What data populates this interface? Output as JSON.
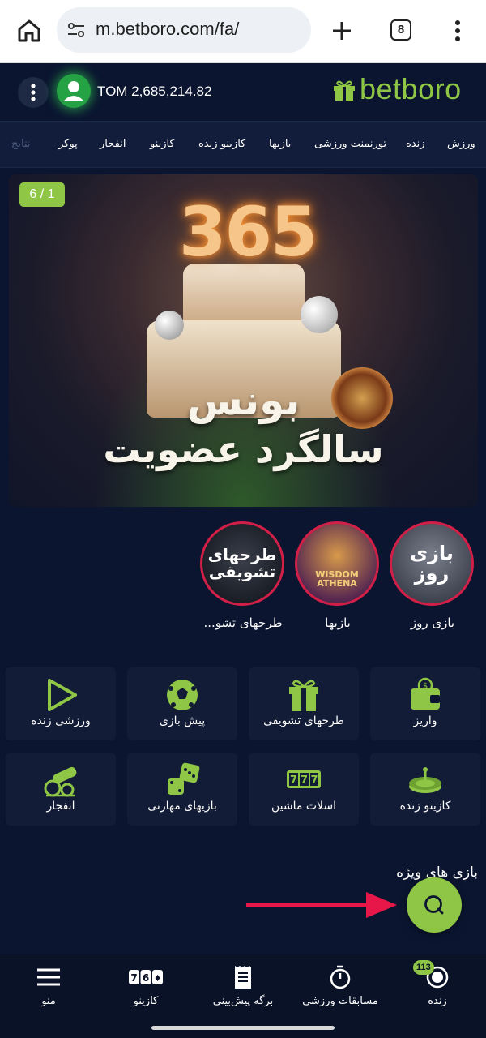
{
  "browser": {
    "url": "m.betboro.com/fa/",
    "tab_count": "8"
  },
  "header": {
    "balance": "TOM 2,685,214.82",
    "logo_text": "betboro"
  },
  "category_nav": {
    "items": [
      "ورزش",
      "زنده",
      "تورنمنت ورزشی",
      "بازیها",
      "کازینو زنده",
      "کازینو",
      "انفجار",
      "پوکر",
      "نتایج"
    ]
  },
  "banner": {
    "counter": "6 / 1",
    "badge_number": "365",
    "line1": "بونس",
    "line2": "سالگرد عضویت"
  },
  "stories": [
    {
      "label": "بازی روز",
      "art_text": "بازی روز"
    },
    {
      "label": "بازیها",
      "art_text": "WISDOM ATHENA"
    },
    {
      "label": "طرحهای تشو...",
      "art_text": "طرحهای تشویقی"
    }
  ],
  "tiles": [
    {
      "label": "واریز",
      "icon": "wallet-icon"
    },
    {
      "label": "طرحهای تشویقی",
      "icon": "gift-icon"
    },
    {
      "label": "پیش بازی",
      "icon": "soccer-ball-icon"
    },
    {
      "label": "ورزشی زنده",
      "icon": "play-icon"
    },
    {
      "label": "کازینو زنده",
      "icon": "roulette-icon"
    },
    {
      "label": "اسلات ماشین",
      "icon": "slot-777-icon"
    },
    {
      "label": "بازیهای مهارتی",
      "icon": "dice-icon"
    },
    {
      "label": "انفجار",
      "icon": "cannon-icon"
    }
  ],
  "special_games_title": "بازی های ویژه",
  "bottom_nav": {
    "items": [
      {
        "label": "زنده",
        "icon": "live-icon"
      },
      {
        "label": "مسابقات ورزشی",
        "icon": "stopwatch-icon"
      },
      {
        "label": "برگه پیش‌بینی",
        "icon": "betslip-icon"
      },
      {
        "label": "کازینو",
        "icon": "slot-icon"
      },
      {
        "label": "منو",
        "icon": "hamburger-icon"
      }
    ],
    "live_badge": "113"
  },
  "colors": {
    "accent": "#8fc645",
    "background": "#0b1530",
    "tile": "#121c36",
    "story_ring": "#d21f47",
    "arrow": "#e8174a"
  }
}
